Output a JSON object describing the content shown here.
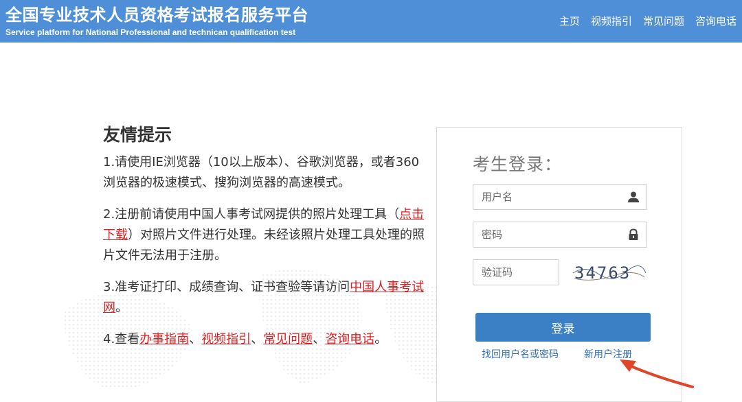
{
  "header": {
    "title": "全国专业技术人员资格考试报名服务平台",
    "subtitle": "Service platform for National Professional and technican qualification test",
    "nav": [
      "主页",
      "视频指引",
      "常见问题",
      "咨询电话"
    ],
    "background_color": "#4f8fd8"
  },
  "tips": {
    "title": "友情提示",
    "items": [
      {
        "parts": [
          "1.请使用IE浏览器（10以上版本）、谷歌浏览器，或者360浏览器的极速模式、搜狗浏览器的高速模式。"
        ]
      },
      {
        "before": "2.注册前请使用中国人事考试网提供的照片处理工具（",
        "link": "点击下载",
        "after": "）对照片文件进行处理。未经该照片处理工具处理的照片文件无法用于注册。"
      },
      {
        "before": "3.准考证打印、成绩查询、证书查验等请访问",
        "link": "中国人事考试网",
        "after": "。"
      },
      {
        "before": "4.查看",
        "links": [
          "办事指南",
          "视频指引",
          "常见问题",
          "咨询电话"
        ],
        "sep": "、",
        "after": "。"
      }
    ],
    "link_color": "#e02020"
  },
  "login": {
    "title": "考生登录：",
    "username_placeholder": "用户名",
    "password_placeholder": "密码",
    "captcha_placeholder": "验证码",
    "captcha_text": "34763",
    "submit_label": "登录",
    "forgot_link": "找回用户名或密码",
    "register_link": "新用户注册",
    "button_color": "#3b7fc4"
  },
  "icons": {
    "username": "user-icon",
    "password": "lock-icon",
    "annotation": "red-arrow-icon"
  }
}
